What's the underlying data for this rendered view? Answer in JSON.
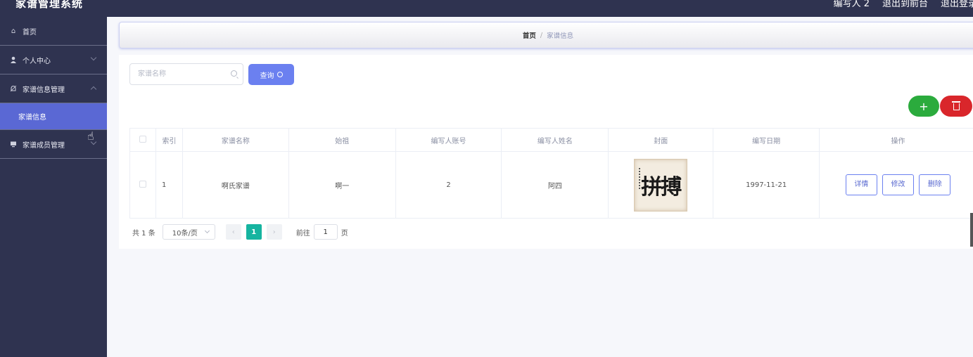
{
  "app": {
    "title": "家谱管理系统"
  },
  "top_links": [
    "编写人 2",
    "退出到前台",
    "退出登录"
  ],
  "sidebar": {
    "items": [
      {
        "label": "首页",
        "icon": "home-icon"
      },
      {
        "label": "个人中心",
        "icon": "user-icon"
      },
      {
        "label": "家谱信息管理",
        "icon": "bell-icon"
      },
      {
        "label": "家谱成员管理",
        "icon": "monitor-icon"
      }
    ],
    "sub_items": [
      {
        "label": "家谱信息"
      }
    ]
  },
  "breadcrumb": {
    "home": "首页",
    "separator": "/",
    "current": "家谱信息"
  },
  "search": {
    "placeholder": "家谱名称",
    "value": "",
    "button_label": "查询"
  },
  "actions": {
    "add_symbol": "+"
  },
  "table": {
    "headers": [
      "索引",
      "家谱名称",
      "始祖",
      "编写人账号",
      "编写人姓名",
      "封面",
      "编写日期",
      "操作"
    ],
    "rows": [
      {
        "index": "1",
        "name": "啊氏家谱",
        "ancestor": "啊一",
        "account": "2",
        "author": "阿四",
        "date": "1997-11-21"
      }
    ],
    "row_actions": [
      "详情",
      "修改",
      "删除"
    ]
  },
  "cover_art": {
    "calligraphy": "拼搏"
  },
  "pagination": {
    "total": "共 1 条",
    "page_size": "10条/页",
    "current_page": "1",
    "goto_label": "前往",
    "goto_value": "1",
    "page_unit": "页",
    "prev": "‹",
    "next": "›"
  },
  "colors": {
    "sidebar": "#2f3350",
    "active": "#5a68d4",
    "primary": "#6b80f0",
    "add": "#2bab3d",
    "delete": "#d9262b",
    "pager_active": "#16b4a0"
  }
}
